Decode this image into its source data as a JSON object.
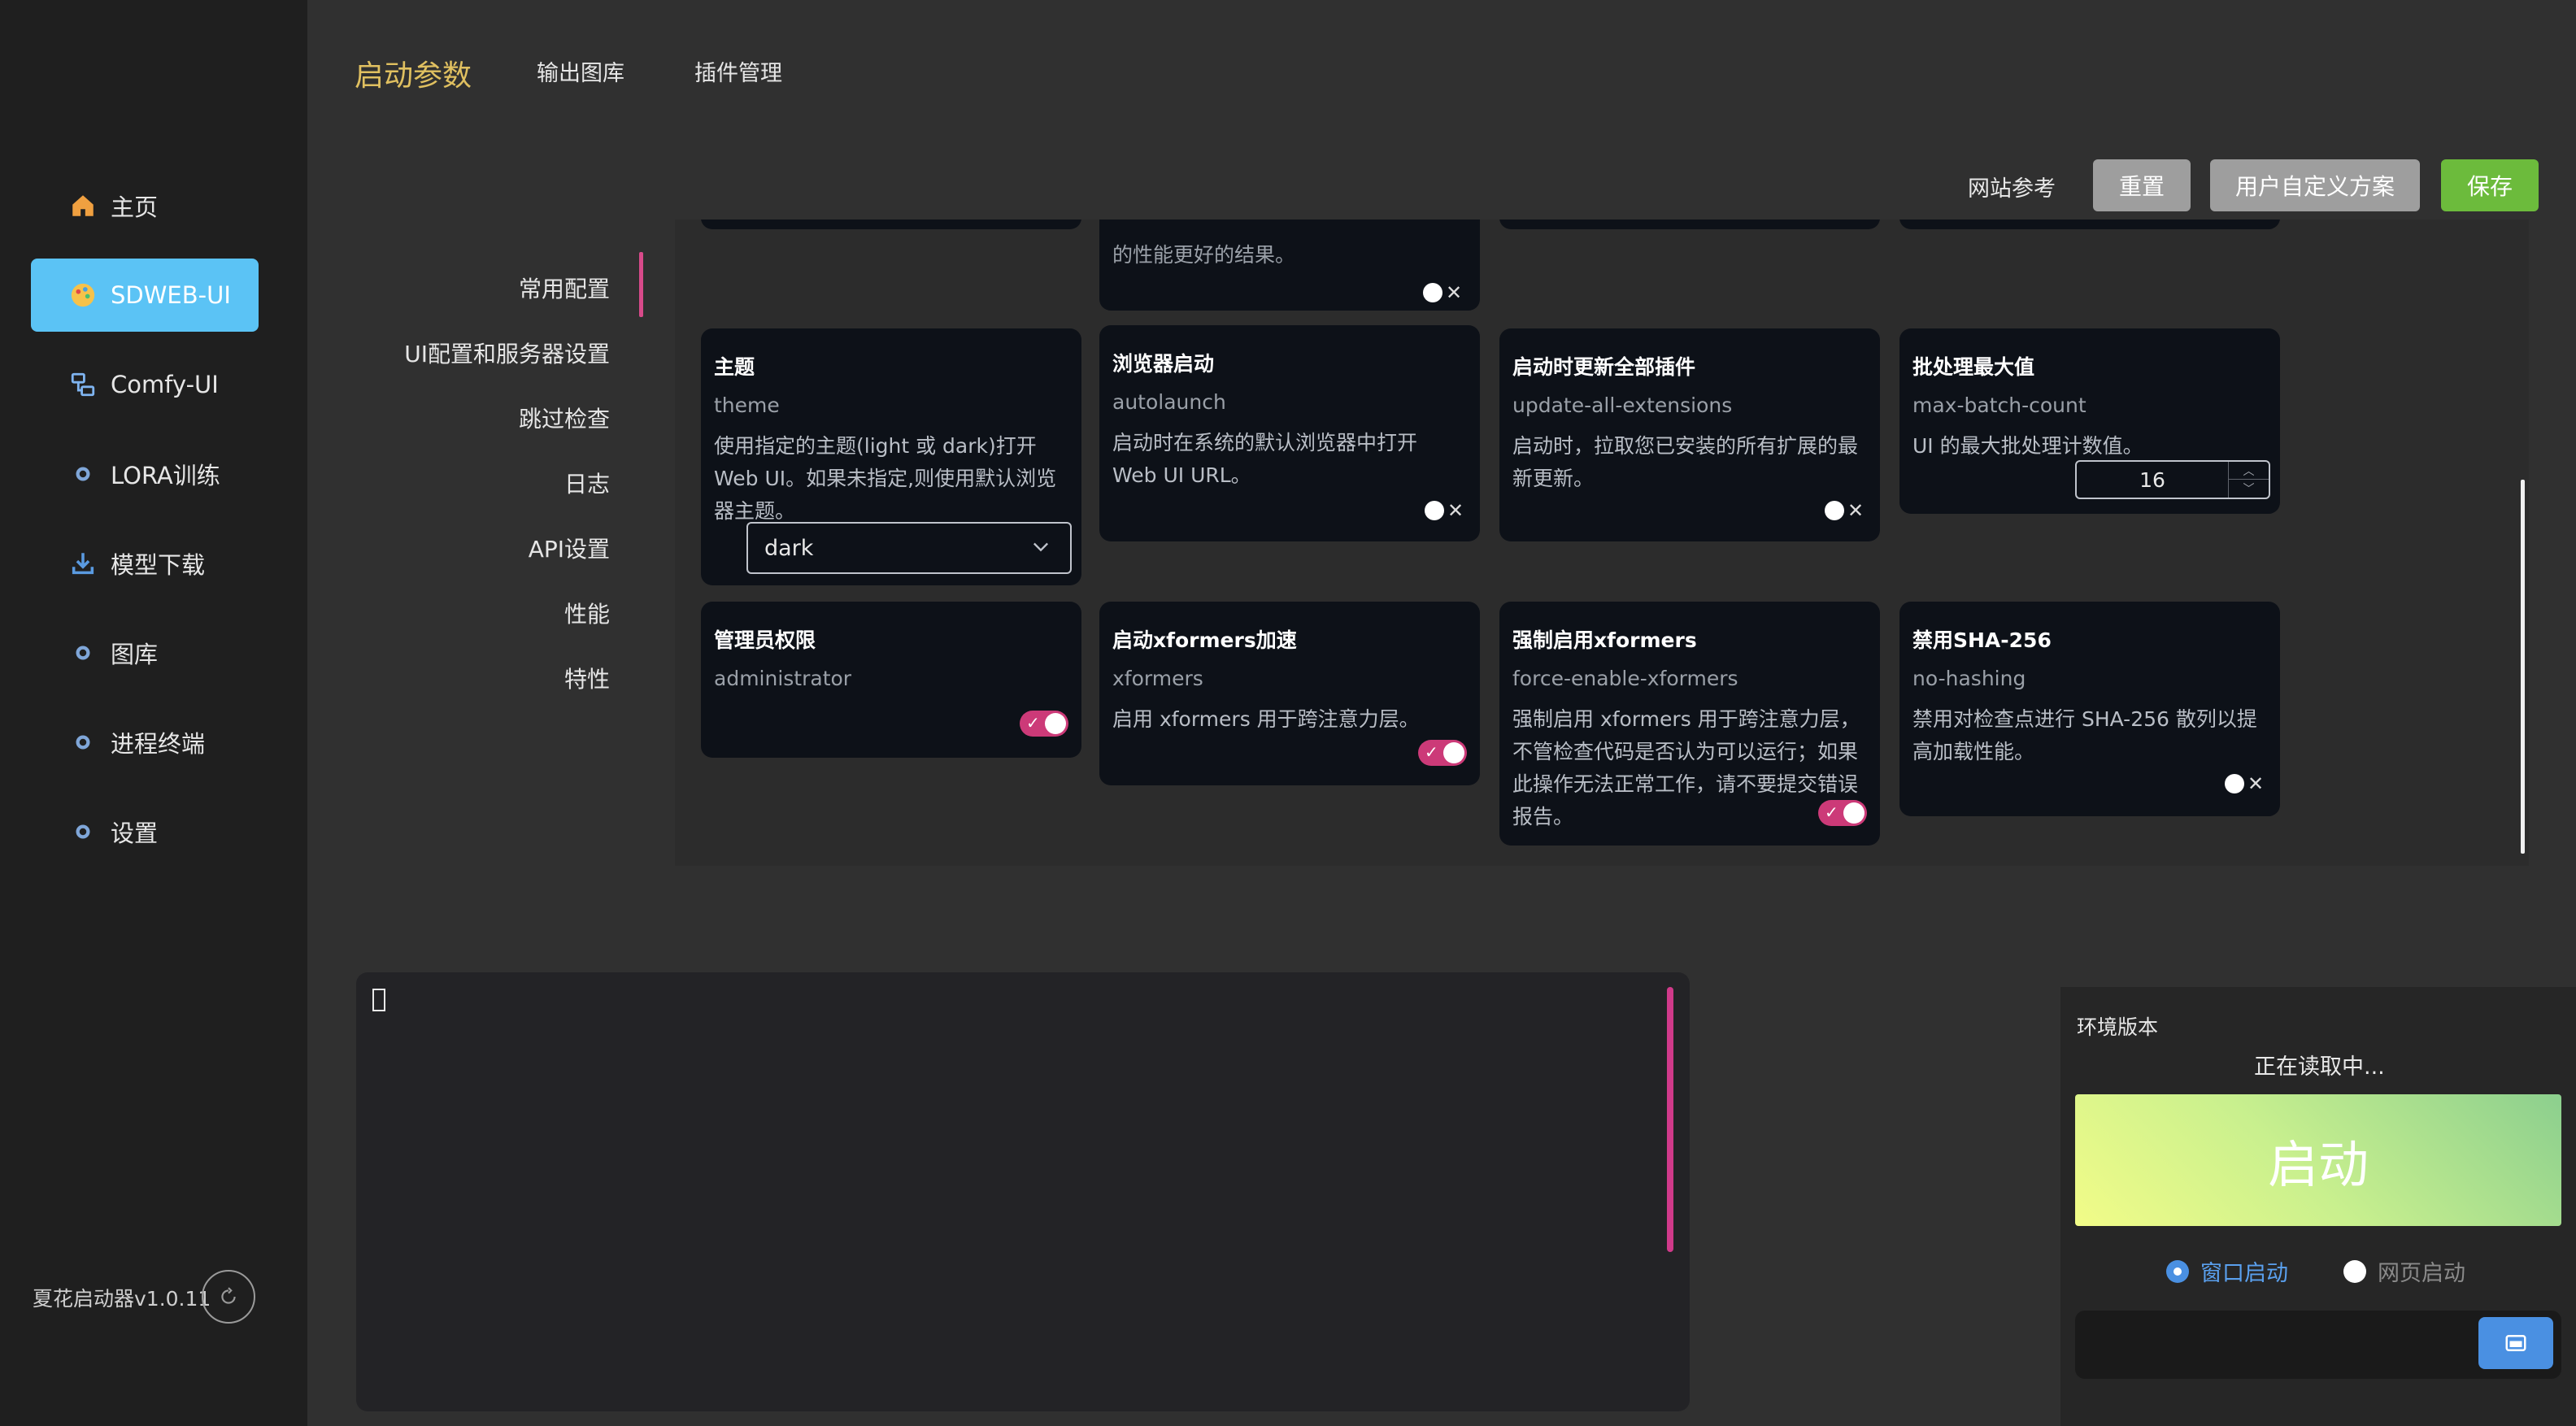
{
  "sidebar": {
    "items": [
      {
        "label": "主页",
        "icon": "home-icon"
      },
      {
        "label": "SDWEB-UI",
        "icon": "palette-icon"
      },
      {
        "label": "Comfy-UI",
        "icon": "flow-icon"
      },
      {
        "label": "LORA训练",
        "icon": "bullet-icon"
      },
      {
        "label": "模型下载",
        "icon": "download-icon"
      },
      {
        "label": "图库",
        "icon": "bullet-icon"
      },
      {
        "label": "进程终端",
        "icon": "bullet-icon"
      },
      {
        "label": "设置",
        "icon": "bullet-icon"
      }
    ],
    "version": "夏花启动器v1.0.11"
  },
  "top_tabs": {
    "active": "启动参数",
    "tab2": "输出图库",
    "tab3": "插件管理"
  },
  "toolbar": {
    "site_ref": "网站参考",
    "reset": "重置",
    "custom": "用户自定义方案",
    "save": "保存"
  },
  "subnav": {
    "items": [
      "常用配置",
      "UI配置和服务器设置",
      "跳过检查",
      "日志",
      "API设置",
      "性能",
      "特性"
    ]
  },
  "cards": {
    "partial_desc": "的性能更好的结果。",
    "theme": {
      "title": "主题",
      "key": "theme",
      "desc": "使用指定的主题(light 或 dark)打开 Web UI。如果未指定,则使用默认浏览器主题。",
      "value": "dark"
    },
    "autolaunch": {
      "title": "浏览器启动",
      "key": "autolaunch",
      "desc": "启动时在系统的默认浏览器中打开 Web UI URL。"
    },
    "update_ext": {
      "title": "启动时更新全部插件",
      "key": "update-all-extensions",
      "desc": "启动时，拉取您已安装的所有扩展的最新更新。"
    },
    "max_batch": {
      "title": "批处理最大值",
      "key": "max-batch-count",
      "desc": "UI 的最大批处理计数值。",
      "value": "16"
    },
    "admin": {
      "title": "管理员权限",
      "key": "administrator"
    },
    "xformers": {
      "title": "启动xformers加速",
      "key": "xformers",
      "desc": "启用 xformers 用于跨注意力层。"
    },
    "force_xformers": {
      "title": "强制启用xformers",
      "key": "force-enable-xformers",
      "desc": "强制启用 xformers 用于跨注意力层，不管检查代码是否认为可以运行；如果此操作无法正常工作，请不要提交错误报告。"
    },
    "no_hashing": {
      "title": "禁用SHA-256",
      "key": "no-hashing",
      "desc": "禁用对检查点进行 SHA-256 散列以提高加载性能。"
    }
  },
  "launch": {
    "env_label": "环境版本",
    "env_status": "正在读取中...",
    "start": "启动",
    "mode_window": "窗口启动",
    "mode_web": "网页启动",
    "selected_mode": "窗口启动"
  },
  "colors": {
    "accent_tab": "#e0c060",
    "active_nav": "#5bc3f5",
    "toggle_on": "#cc3a78",
    "save_green": "#6cbb3c",
    "blue": "#4a90e2"
  }
}
